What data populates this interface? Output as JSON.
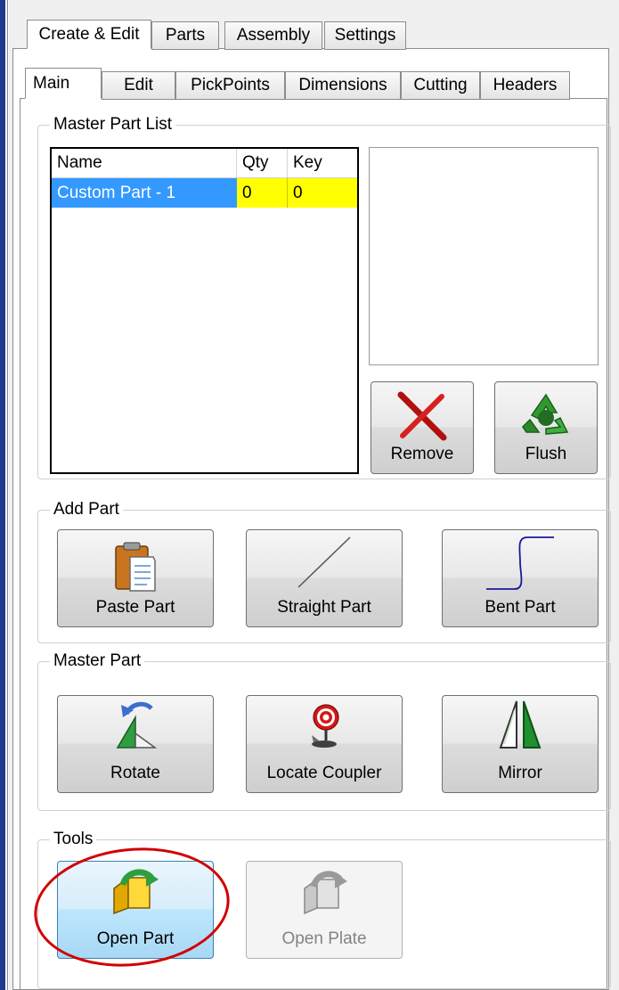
{
  "top_tabs": [
    {
      "label": "Create & Edit",
      "active": true
    },
    {
      "label": "Parts",
      "active": false
    },
    {
      "label": "Assembly",
      "active": false
    },
    {
      "label": "Settings",
      "active": false
    }
  ],
  "sub_tabs": [
    {
      "label": "Main",
      "active": true
    },
    {
      "label": "Edit",
      "active": false
    },
    {
      "label": "PickPoints",
      "active": false
    },
    {
      "label": "Dimensions",
      "active": false
    },
    {
      "label": "Cutting",
      "active": false
    },
    {
      "label": "Headers",
      "active": false
    }
  ],
  "master_part_list": {
    "title": "Master Part List",
    "columns": [
      "Name",
      "Qty",
      "Key"
    ],
    "rows": [
      {
        "name": "Custom Part - 1",
        "qty": "0",
        "key": "0",
        "selected": true
      }
    ],
    "remove_label": "Remove",
    "flush_label": "Flush"
  },
  "add_part": {
    "title": "Add Part",
    "paste_label": "Paste Part",
    "straight_label": "Straight Part",
    "bent_label": "Bent Part"
  },
  "master_part": {
    "title": "Master Part",
    "rotate_label": "Rotate",
    "locate_label": "Locate Coupler",
    "mirror_label": "Mirror"
  },
  "tools": {
    "title": "Tools",
    "open_part_label": "Open Part",
    "open_plate_label": "Open Plate"
  },
  "colors": {
    "selection": "#3399ff",
    "highlight_cell": "#ffff00",
    "annotation": "#d20000"
  }
}
